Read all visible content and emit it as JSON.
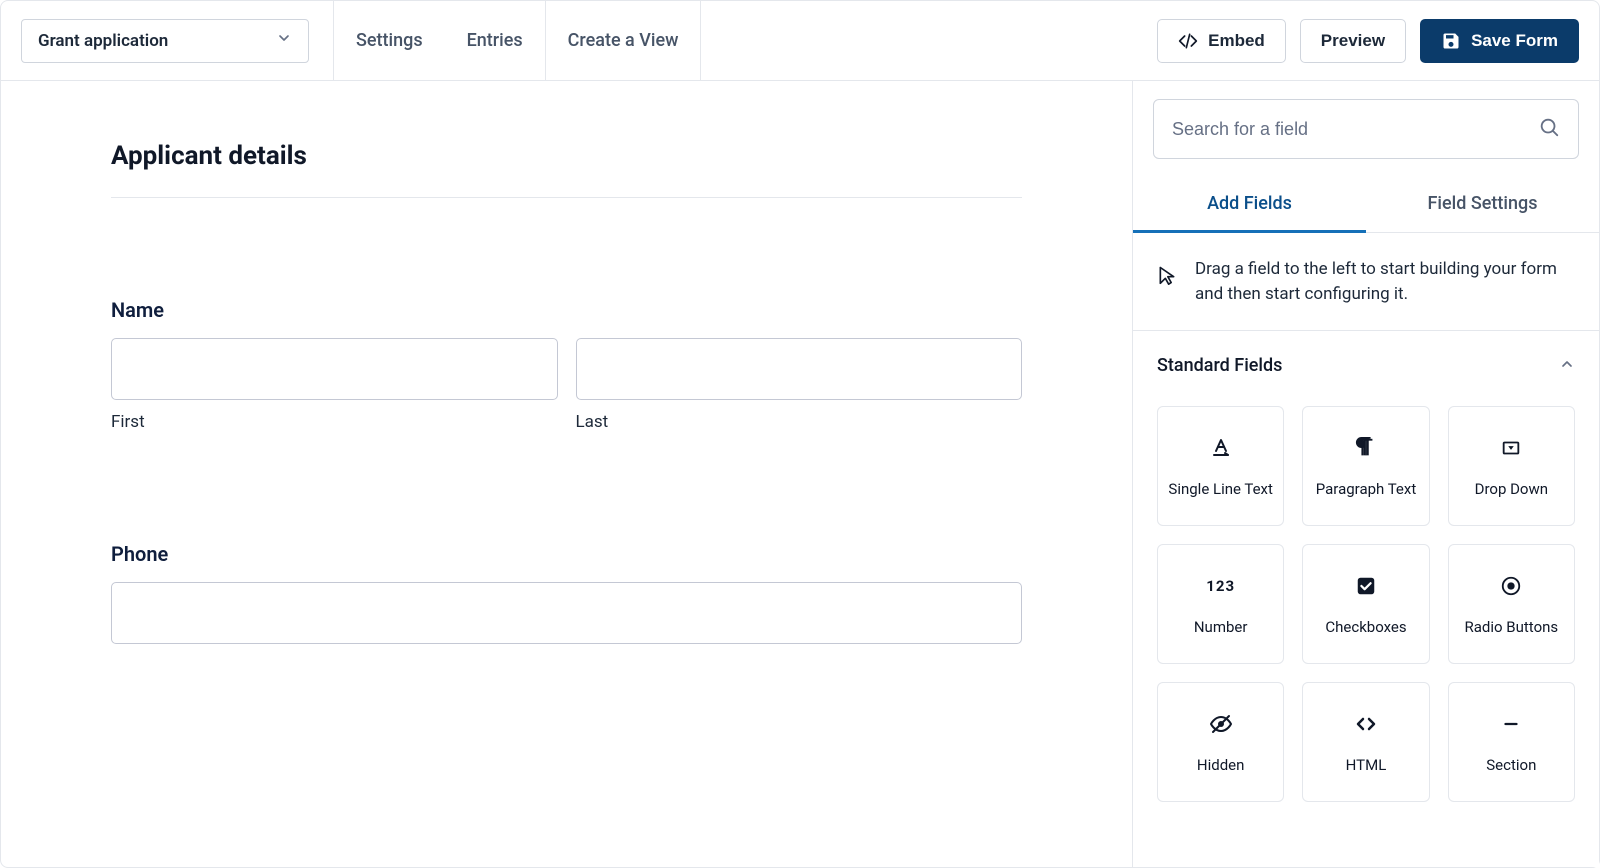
{
  "topbar": {
    "form_title": "Grant application",
    "nav": {
      "settings": "Settings",
      "entries": "Entries",
      "create_view": "Create a View"
    },
    "embed_label": "Embed",
    "preview_label": "Preview",
    "save_label": "Save Form"
  },
  "canvas": {
    "title": "Applicant details",
    "name": {
      "label": "Name",
      "first_sub": "First",
      "last_sub": "Last"
    },
    "phone": {
      "label": "Phone"
    }
  },
  "sidebar": {
    "search_placeholder": "Search for a field",
    "tabs": {
      "add_fields": "Add Fields",
      "field_settings": "Field Settings"
    },
    "hint": "Drag a field to the left to start building your form and then start configuring it.",
    "section_title": "Standard Fields",
    "fields": {
      "single_line": "Single Line Text",
      "paragraph": "Paragraph Text",
      "dropdown": "Drop Down",
      "number": "Number",
      "checkboxes": "Checkboxes",
      "radio": "Radio Buttons",
      "hidden": "Hidden",
      "html": "HTML",
      "section": "Section"
    }
  }
}
